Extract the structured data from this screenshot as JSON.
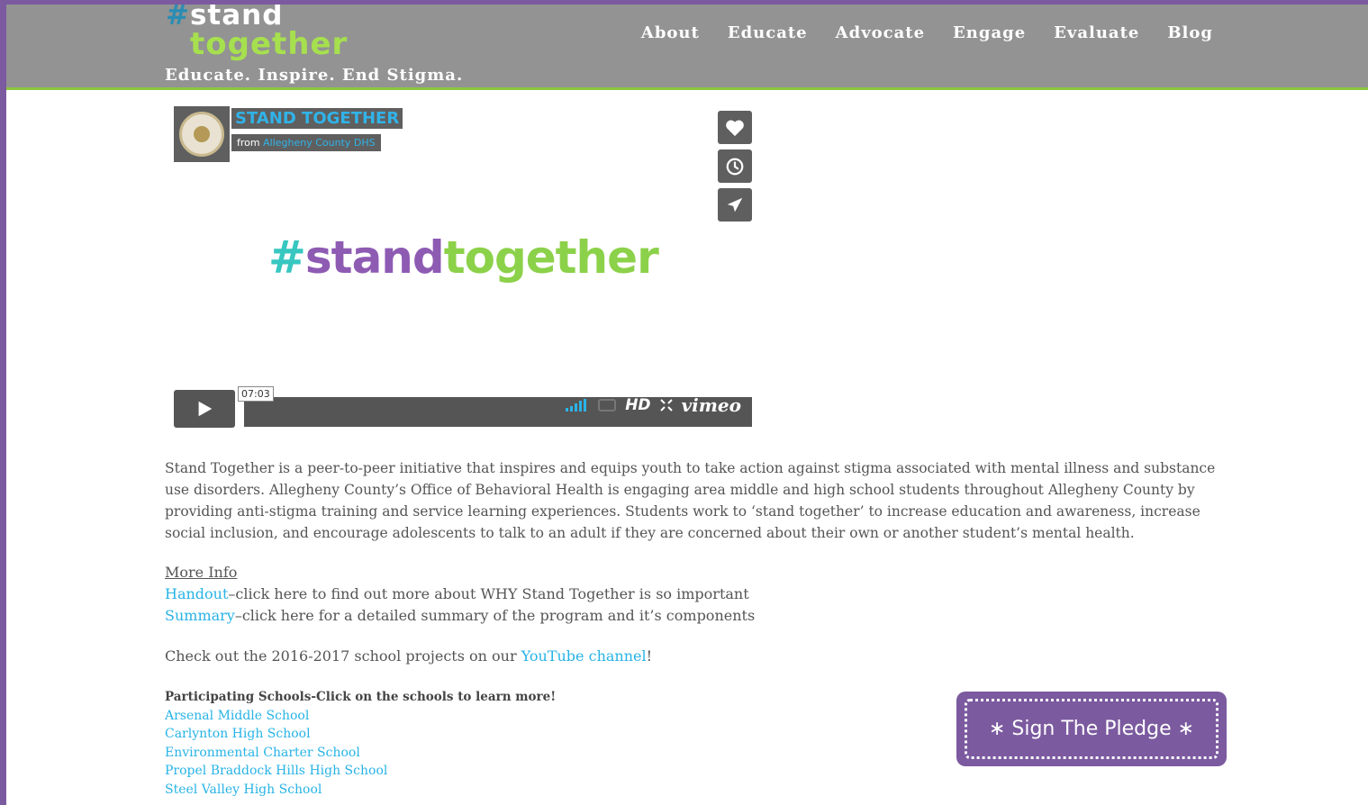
{
  "header": {
    "logo_hash": "#",
    "logo_word1": "stand",
    "logo_word2": "together",
    "tagline": "Educate. Inspire. End Stigma.",
    "nav": [
      "About",
      "Educate",
      "Advocate",
      "Engage",
      "Evaluate",
      "Blog"
    ]
  },
  "video": {
    "badge_title": "STAND TOGETHER",
    "badge_from": "from",
    "badge_org": "Allegheny County DHS",
    "hashtag_hash": "#",
    "hashtag_stand": "stand",
    "hashtag_together": "together",
    "timecode": "07:03",
    "hd_label": "HD",
    "vimeo_label": "vimeo"
  },
  "intro": {
    "paragraph": "Stand Together is a peer-to-peer initiative that inspires and equips youth to take action against stigma associated with mental illness and substance use disorders. Allegheny County’s Office of Behavioral Health is engaging area middle and high school students throughout Allegheny County by providing anti-stigma training and service learning experiences. Students work to ‘stand together’ to increase education and awareness, increase social inclusion, and encourage adolescents to talk to an adult if they are concerned about their own or another student’s mental health."
  },
  "more_info": {
    "title": "More Info",
    "handout_link": "Handout",
    "handout_text": "–click here to find out more about WHY Stand Together is so important",
    "summary_link": "Summary",
    "summary_text": "–click here for a detailed summary of the program and it’s components"
  },
  "youtube": {
    "prefix": "Check out the 2016-2017 school projects on our ",
    "link": "YouTube channel",
    "suffix": "!"
  },
  "schools": {
    "heading": "Participating Schools-Click on the schools to learn more!",
    "items": [
      "Arsenal Middle School",
      "Carlynton High School",
      "Environmental Charter School",
      "Propel Braddock Hills High School",
      "Steel Valley High School"
    ]
  },
  "pledge": {
    "label": "∗ Sign The Pledge ∗"
  },
  "colors": {
    "purple": "#7b5a9f",
    "header_gray": "#939393",
    "green": "#8cc63f",
    "link_blue": "#27b3e6"
  }
}
